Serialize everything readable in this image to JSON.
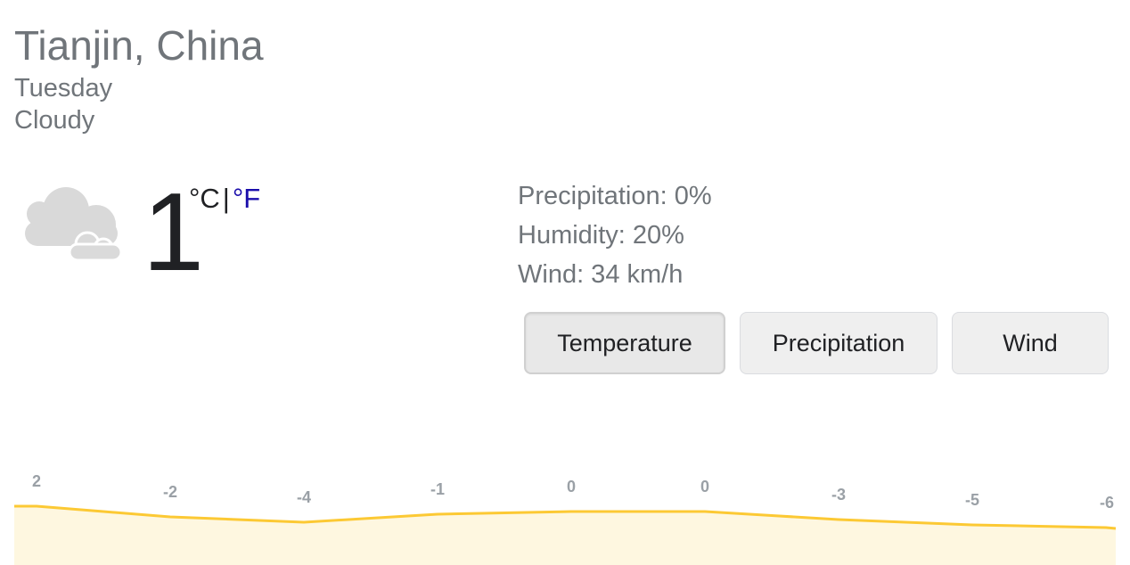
{
  "location": "Tianjin, China",
  "day": "Tuesday",
  "condition": "Cloudy",
  "current": {
    "temperature": "1",
    "unit_c": "°C",
    "separator": "|",
    "unit_f": "°F",
    "icon": "cloudy-icon"
  },
  "details": {
    "precipitation": "Precipitation: 0%",
    "humidity": "Humidity: 20%",
    "wind": "Wind: 34 km/h"
  },
  "tabs": [
    {
      "label": "Temperature",
      "active": true
    },
    {
      "label": "Precipitation",
      "active": false
    },
    {
      "label": "Wind",
      "active": false
    }
  ],
  "colors": {
    "line": "#fcc934",
    "fill": "#fef7e0",
    "label": "#9aa0a6",
    "link": "#1a0dab"
  },
  "chart_data": {
    "type": "area",
    "values": [
      2,
      -2,
      -4,
      -1,
      0,
      0,
      -3,
      -5,
      -6
    ],
    "labels": [
      "2",
      "-2",
      "-4",
      "-1",
      "0",
      "0",
      "-3",
      "-5",
      "-6"
    ]
  }
}
